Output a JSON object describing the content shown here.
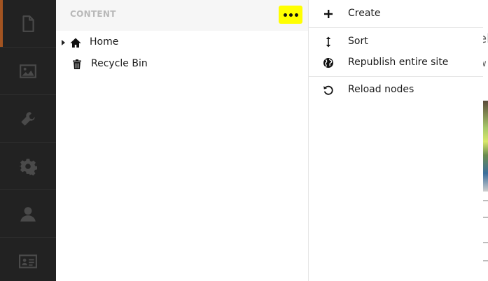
{
  "rail": {
    "items": [
      {
        "name": "content",
        "icon": "document-icon",
        "active": true
      },
      {
        "name": "media",
        "icon": "image-icon",
        "active": false
      },
      {
        "name": "developer",
        "icon": "wrench-icon",
        "active": false
      },
      {
        "name": "settings",
        "icon": "gear-icon",
        "active": false
      },
      {
        "name": "users",
        "icon": "user-icon",
        "active": false
      },
      {
        "name": "members",
        "icon": "id-card-icon",
        "active": false
      }
    ]
  },
  "tree": {
    "section_title": "CONTENT",
    "nodes": [
      {
        "label": "Home",
        "icon": "home-icon",
        "has_children": true
      },
      {
        "label": "Recycle Bin",
        "icon": "trash-icon",
        "has_children": false
      }
    ]
  },
  "menu": {
    "items": [
      {
        "label": "Create",
        "icon": "plus-icon"
      },
      {
        "label": "Sort",
        "icon": "vertical-arrows-icon"
      },
      {
        "label": "Republish entire site",
        "icon": "globe-icon"
      },
      {
        "label": "Reload nodes",
        "icon": "reload-icon"
      }
    ]
  },
  "edge": {
    "fragments": [
      "el",
      "w"
    ]
  },
  "colors": {
    "rail_bg": "#222222",
    "rail_active_accent": "#a35421",
    "rail_icon": "#4a4a4a",
    "header_bg": "#f6f6f6",
    "highlight": "#ffff00",
    "text": "#1b1b1b"
  }
}
